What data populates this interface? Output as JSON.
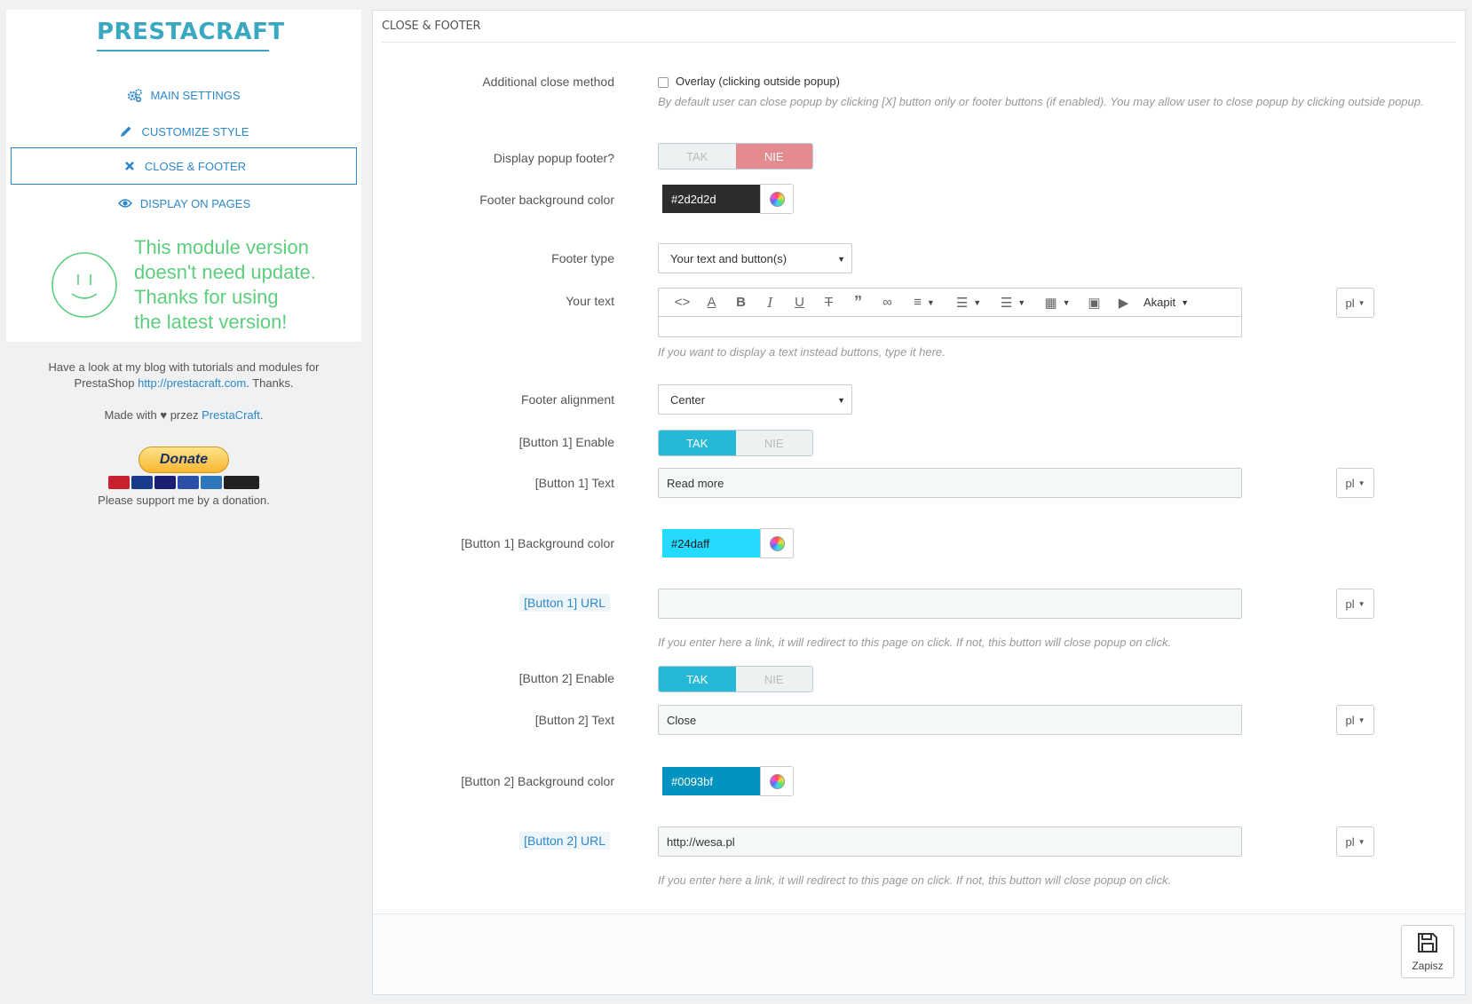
{
  "sidebar": {
    "logo": "PRESTACRAFT",
    "nav": [
      {
        "label": "MAIN SETTINGS",
        "icon": "cogs-icon"
      },
      {
        "label": "CUSTOMIZE STYLE",
        "icon": "pencil-icon"
      },
      {
        "label": "CLOSE & FOOTER",
        "icon": "close-icon",
        "active": true
      },
      {
        "label": "DISPLAY ON PAGES",
        "icon": "eye-icon"
      }
    ],
    "update_lines": [
      "This module version",
      "doesn't need update.",
      "Thanks for using",
      "the latest version!"
    ],
    "blog_text_1": "Have a look at my blog with tutorials and modules for",
    "blog_text_2": "PrestaShop ",
    "blog_link": "http://prestacraft.com",
    "blog_text_3": ". Thanks.",
    "made_with_1": "Made with ",
    "made_with_2": " przez ",
    "made_with_link": "PrestaCraft",
    "donate": "Donate",
    "support": "Please support me by a donation."
  },
  "panel": {
    "title": "CLOSE & FOOTER",
    "close_method": {
      "label": "Additional close method",
      "checkbox_label": "Overlay (clicking outside popup)",
      "help": "By default user can close popup by clicking [X] button only or footer buttons (if enabled). You may allow user to close popup by clicking outside popup."
    },
    "display_footer": {
      "label": "Display popup footer?",
      "yes": "TAK",
      "no": "NIE"
    },
    "footer_bg": {
      "label": "Footer background color",
      "value": "#2d2d2d"
    },
    "footer_type": {
      "label": "Footer type",
      "value": "Your text and button(s)"
    },
    "your_text": {
      "label": "Your text",
      "format": "Akapit",
      "lang": "pl",
      "help": "If you want to display a text instead buttons, type it here."
    },
    "footer_align": {
      "label": "Footer alignment",
      "value": "Center"
    },
    "b1_enable": {
      "label": "[Button 1] Enable",
      "yes": "TAK",
      "no": "NIE"
    },
    "b1_text": {
      "label": "[Button 1] Text",
      "value": "Read more",
      "lang": "pl"
    },
    "b1_bg": {
      "label": "[Button 1] Background color",
      "value": "#24daff"
    },
    "b1_url": {
      "label": "[Button 1] URL",
      "value": "",
      "lang": "pl",
      "help": "If you enter here a link, it will redirect to this page on click. If not, this button will close popup on click."
    },
    "b2_enable": {
      "label": "[Button 2] Enable",
      "yes": "TAK",
      "no": "NIE"
    },
    "b2_text": {
      "label": "[Button 2] Text",
      "value": "Close",
      "lang": "pl"
    },
    "b2_bg": {
      "label": "[Button 2] Background color",
      "value": "#0093bf"
    },
    "b2_url": {
      "label": "[Button 2] URL",
      "value": "http://wesa.pl",
      "lang": "pl",
      "help": "If you enter here a link, it will redirect to this page on click. If not, this button will close popup on click."
    },
    "save": "Zapisz"
  },
  "colors": {
    "accent": "#25b9d7",
    "link": "#2d87c8",
    "success": "#5cce7d",
    "danger": "#e38b8f"
  }
}
